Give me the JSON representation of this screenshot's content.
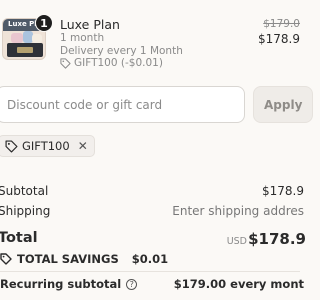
{
  "product": {
    "image_label": "Luxe Pla",
    "quantity": "1",
    "name": "Luxe Plan",
    "term": "1 month",
    "delivery": "Delivery every 1 Month",
    "discount_applied": "GIFT100 (-$0.01)",
    "original_price": "$179.0",
    "price": "$178.9"
  },
  "discount": {
    "placeholder": "Discount code or gift card",
    "apply_label": "Apply",
    "applied_code": "GIFT100"
  },
  "summary": {
    "subtotal_label": "Subtotal",
    "subtotal_value": "$178.9",
    "shipping_label": "Shipping",
    "shipping_value": "Enter shipping addres",
    "total_label": "Total",
    "total_currency": "USD",
    "total_value": "$178.9",
    "savings_label": "TOTAL SAVINGS",
    "savings_value": "$0.01",
    "recurring_label": "Recurring subtotal",
    "recurring_value": "$179.00 every mont"
  },
  "icons": {
    "tag": "tag-icon",
    "close": "close-icon",
    "help": "help-circle-icon"
  },
  "colors": {
    "background": "#fbf9f6",
    "text": "#2b2b2b",
    "muted": "#8a8a8a",
    "apply_button": "#efece8"
  }
}
